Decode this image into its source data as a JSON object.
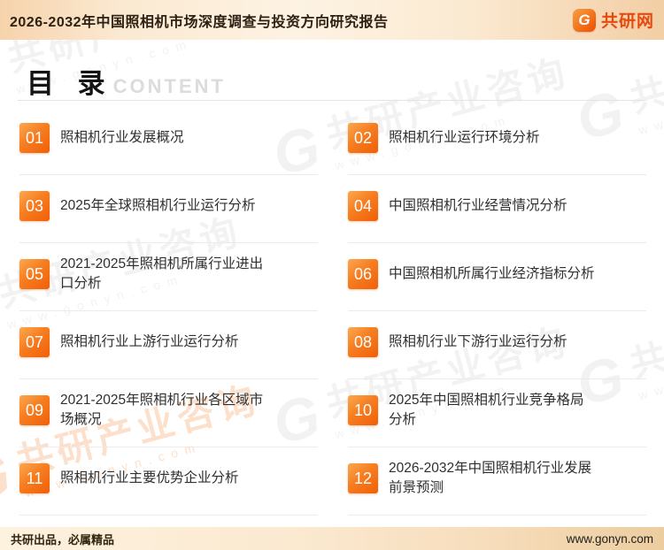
{
  "header": {
    "title": "2026-2032年中国照相机市场深度调查与投资方向研究报告",
    "logo": {
      "glyph": "G",
      "text": "共研网"
    }
  },
  "toc": {
    "heading_cn": "目 录",
    "heading_en": "CONTENT",
    "items": [
      {
        "num": "01",
        "label": "照相机行业发展概况"
      },
      {
        "num": "02",
        "label": "照相机行业运行环境分析"
      },
      {
        "num": "03",
        "label": "2025年全球照相机行业运行分析"
      },
      {
        "num": "04",
        "label": "中国照相机行业经营情况分析"
      },
      {
        "num": "05",
        "label": "2021-2025年照相机所属行业进出口分析"
      },
      {
        "num": "06",
        "label": "中国照相机所属行业经济指标分析"
      },
      {
        "num": "07",
        "label": "照相机行业上游行业运行分析"
      },
      {
        "num": "08",
        "label": "照相机行业下游行业运行分析"
      },
      {
        "num": "09",
        "label": "2021-2025年照相机行业各区域市场概况"
      },
      {
        "num": "10",
        "label": "2025年中国照相机行业竞争格局分析"
      },
      {
        "num": "11",
        "label": "照相机行业主要优势企业分析"
      },
      {
        "num": "12",
        "label": "2026-2032年中国照相机行业发展前景预测"
      }
    ]
  },
  "watermark": {
    "glyph": "G",
    "brand": "共研产业咨询",
    "url": "www.gonyn.com"
  },
  "footer": {
    "left": "共研出品，必属精品",
    "right": "www.gonyn.com"
  },
  "colors": {
    "accent": "#f1620a",
    "accent_light": "#fba850",
    "logo_red": "#e8490f",
    "bar_peach": "#f6d3ab"
  }
}
